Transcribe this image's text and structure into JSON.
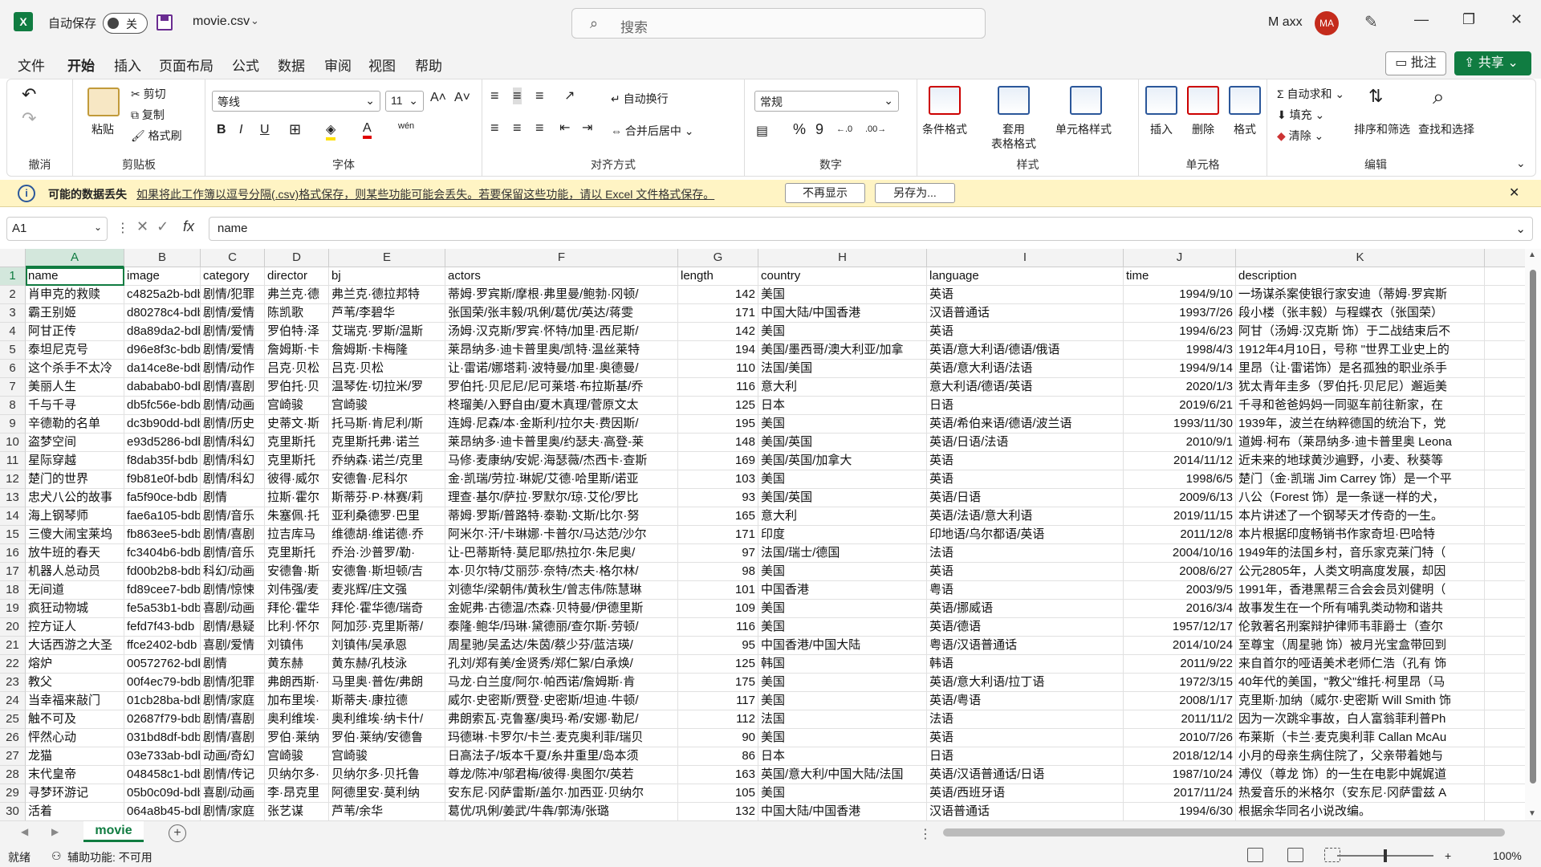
{
  "titlebar": {
    "autosave_label": "自动保存",
    "autosave_state": "关",
    "filename": "movie.csv",
    "search_placeholder": "搜索",
    "user_name": "M axx",
    "avatar_initials": "MA"
  },
  "menu": {
    "tabs": [
      "文件",
      "开始",
      "插入",
      "页面布局",
      "公式",
      "数据",
      "审阅",
      "视图",
      "帮助"
    ],
    "active_tab": "开始",
    "comment_label": "批注",
    "share_label": "共享"
  },
  "ribbon": {
    "undo_group": "撤消",
    "clipboard": {
      "paste": "粘贴",
      "cut": "剪切",
      "copy": "复制",
      "format_painter": "格式刷",
      "label": "剪贴板"
    },
    "font": {
      "name": "等线",
      "size": "11",
      "label": "字体"
    },
    "alignment": {
      "wrap": "自动换行",
      "merge": "合并后居中",
      "label": "对齐方式"
    },
    "number": {
      "format": "常规",
      "label": "数字"
    },
    "styles": {
      "conditional": "条件格式",
      "table_line1": "套用",
      "table_line2": "表格格式",
      "cell_styles": "单元格样式",
      "label": "样式"
    },
    "cells": {
      "insert": "插入",
      "delete": "删除",
      "format": "格式",
      "label": "单元格"
    },
    "editing": {
      "autosum": "自动求和",
      "fill": "填充",
      "clear": "清除",
      "sort_filter": "排序和筛选",
      "find_select": "查找和选择",
      "label": "编辑"
    }
  },
  "infobar": {
    "title": "可能的数据丢失",
    "message": "如果将此工作簿以逗号分隔(.csv)格式保存，则某些功能可能会丢失。若要保留这些功能，请以 Excel 文件格式保存。",
    "dont_show": "不再显示",
    "save_as": "另存为..."
  },
  "formula_bar": {
    "cell_ref": "A1",
    "formula": "name"
  },
  "columns": [
    "A",
    "B",
    "C",
    "D",
    "E",
    "F",
    "G",
    "H",
    "I",
    "J",
    "K"
  ],
  "row_numbers": [
    "1",
    "2",
    "3",
    "4",
    "5",
    "6",
    "7",
    "8",
    "9",
    "10",
    "11",
    "12",
    "13",
    "14",
    "15",
    "16",
    "17",
    "18",
    "19",
    "20",
    "21",
    "22",
    "23",
    "24",
    "25",
    "26",
    "27",
    "28",
    "29",
    "30"
  ],
  "rows": [
    [
      "name",
      "image",
      "category",
      "director",
      "bj",
      "actors",
      "length",
      "country",
      "language",
      "time",
      "description"
    ],
    [
      "肖申克的救赎",
      "c4825a2b-bdb",
      "剧情/犯罪",
      "弗兰克·德",
      "弗兰克·德拉邦特",
      "蒂姆·罗宾斯/摩根·弗里曼/鲍勃·冈顿/",
      "142",
      "美国",
      "英语",
      "1994/9/10",
      "一场谋杀案使银行家安迪（蒂姆·罗宾斯"
    ],
    [
      "霸王别姬",
      "d80278c4-bdb",
      "剧情/爱情",
      "陈凯歌",
      "芦苇/李碧华",
      "张国荣/张丰毅/巩俐/葛优/英达/蒋雯",
      "171",
      "中国大陆/中国香港",
      "汉语普通话",
      "1993/7/26",
      "段小楼（张丰毅）与程蝶衣（张国荣）"
    ],
    [
      "阿甘正传",
      "d8a89da2-bdb",
      "剧情/爱情",
      "罗伯特·泽",
      "艾瑞克·罗斯/温斯",
      "汤姆·汉克斯/罗宾·怀特/加里·西尼斯/",
      "142",
      "美国",
      "英语",
      "1994/6/23",
      "阿甘（汤姆·汉克斯 饰）于二战结束后不"
    ],
    [
      "泰坦尼克号",
      "d96e8f3c-bdb",
      "剧情/爱情",
      "詹姆斯·卡",
      "詹姆斯·卡梅隆",
      "莱昂纳多·迪卡普里奥/凯特·温丝莱特",
      "194",
      "美国/墨西哥/澳大利亚/加拿",
      "英语/意大利语/德语/俄语",
      "1998/4/3",
      "1912年4月10日，号称 \"世界工业史上的"
    ],
    [
      "这个杀手不太冷",
      "da14ce8e-bdb",
      "剧情/动作",
      "吕克·贝松",
      "吕克·贝松",
      "让·雷诺/娜塔莉·波特曼/加里·奥德曼/",
      "110",
      "法国/美国",
      "英语/意大利语/法语",
      "1994/9/14",
      "里昂（让·雷诺饰）是名孤独的职业杀手"
    ],
    [
      "美丽人生",
      "dababab0-bdb",
      "剧情/喜剧",
      "罗伯托·贝",
      "温琴佐·切拉米/罗",
      "罗伯托·贝尼尼/尼可莱塔·布拉斯基/乔",
      "116",
      "意大利",
      "意大利语/德语/英语",
      "2020/1/3",
      "犹太青年圭多（罗伯托·贝尼尼）邂逅美"
    ],
    [
      "千与千寻",
      "db5fc56e-bdb",
      "剧情/动画",
      "宫崎骏",
      "宫崎骏",
      "柊瑠美/入野自由/夏木真理/菅原文太",
      "125",
      "日本",
      "日语",
      "2019/6/21",
      "千寻和爸爸妈妈一同驱车前往新家，在"
    ],
    [
      "辛德勒的名单",
      "dc3b90dd-bdb",
      "剧情/历史",
      "史蒂文·斯",
      "托马斯·肯尼利/斯",
      "连姆·尼森/本·金斯利/拉尔夫·费因斯/",
      "195",
      "美国",
      "英语/希伯来语/德语/波兰语",
      "1993/11/30",
      "1939年，波兰在纳粹德国的统治下，党"
    ],
    [
      "盗梦空间",
      "e93d5286-bdb",
      "剧情/科幻",
      "克里斯托",
      "克里斯托弗·诺兰",
      "莱昂纳多·迪卡普里奥/约瑟夫·高登-莱",
      "148",
      "美国/英国",
      "英语/日语/法语",
      "2010/9/1",
      "道姆·柯布（莱昂纳多·迪卡普里奥 Leona"
    ],
    [
      "星际穿越",
      "f8dab35f-bdb",
      "剧情/科幻",
      "克里斯托",
      "乔纳森·诺兰/克里",
      "马修·麦康纳/安妮·海瑟薇/杰西卡·查斯",
      "169",
      "美国/英国/加拿大",
      "英语",
      "2014/11/12",
      "近未来的地球黄沙遍野，小麦、秋葵等"
    ],
    [
      "楚门的世界",
      "f9b81e0f-bdb",
      "剧情/科幻",
      "彼得·威尔",
      "安德鲁·尼科尔",
      "金·凯瑞/劳拉·琳妮/艾德·哈里斯/诺亚",
      "103",
      "美国",
      "英语",
      "1998/6/5",
      "楚门（金·凯瑞 Jim Carrey 饰）是一个平"
    ],
    [
      "忠犬八公的故事",
      "fa5f90ce-bdb",
      "剧情",
      "拉斯·霍尔",
      "斯蒂芬·P·林赛/莉",
      "理查·基尔/萨拉·罗默尔/琼·艾伦/罗比",
      "93",
      "美国/英国",
      "英语/日语",
      "2009/6/13",
      "八公（Forest 饰）是一条谜一样的犬，"
    ],
    [
      "海上钢琴师",
      "fae6a105-bdb",
      "剧情/音乐",
      "朱塞佩·托",
      "亚利桑德罗·巴里",
      "蒂姆·罗斯/普路特·泰勒·文斯/比尔·努",
      "165",
      "意大利",
      "英语/法语/意大利语",
      "2019/11/15",
      "本片讲述了一个钢琴天才传奇的一生。"
    ],
    [
      "三傻大闹宝莱坞",
      "fb863ee5-bdb",
      "剧情/喜剧",
      "拉吉库马",
      "维德胡·维诺德·乔",
      "阿米尔·汗/卡琳娜·卡普尔/马达范/沙尔",
      "171",
      "印度",
      "印地语/乌尔都语/英语",
      "2011/12/8",
      "本片根据印度畅销书作家奇坦·巴哈特"
    ],
    [
      "放牛班的春天",
      "fc3404b6-bdb",
      "剧情/音乐",
      "克里斯托",
      "乔治·沙普罗/勒·",
      "让-巴蒂斯特·莫尼耶/热拉尔·朱尼奥/",
      "97",
      "法国/瑞士/德国",
      "法语",
      "2004/10/16",
      "1949年的法国乡村，音乐家克莱门特（"
    ],
    [
      "机器人总动员",
      "fd00b2b8-bdb",
      "科幻/动画",
      "安德鲁·斯",
      "安德鲁·斯坦顿/吉",
      "本·贝尔特/艾丽莎·奈特/杰夫·格尔林/",
      "98",
      "美国",
      "英语",
      "2008/6/27",
      "公元2805年，人类文明高度发展，却因"
    ],
    [
      "无间道",
      "fd89cee7-bdb",
      "剧情/惊悚",
      "刘伟强/麦",
      "麦兆辉/庄文强",
      "刘德华/梁朝伟/黄秋生/曾志伟/陈慧琳",
      "101",
      "中国香港",
      "粤语",
      "2003/9/5",
      "1991年，香港黑帮三合会会员刘健明（"
    ],
    [
      "疯狂动物城",
      "fe5a53b1-bdb",
      "喜剧/动画",
      "拜伦·霍华",
      "拜伦·霍华德/瑞奇",
      "金妮弗·古德温/杰森·贝特曼/伊德里斯",
      "109",
      "美国",
      "英语/挪威语",
      "2016/3/4",
      "故事发生在一个所有哺乳类动物和谐共"
    ],
    [
      "控方证人",
      "fefd7f43-bdb",
      "剧情/悬疑",
      "比利·怀尔",
      "阿加莎·克里斯蒂/",
      "泰隆·鲍华/玛琳·黛德丽/查尔斯·劳顿/",
      "116",
      "美国",
      "英语/德语",
      "1957/12/17",
      "伦敦著名刑案辩护律师韦菲爵士（查尔"
    ],
    [
      "大话西游之大圣",
      "ffce2402-bdb",
      "喜剧/爱情",
      "刘镇伟",
      "刘镇伟/吴承恩",
      "周星驰/吴孟达/朱茵/蔡少芬/蓝洁瑛/",
      "95",
      "中国香港/中国大陆",
      "粤语/汉语普通话",
      "2014/10/24",
      "至尊宝（周星驰 饰）被月光宝盒带回到"
    ],
    [
      "熔炉",
      "00572762-bdb",
      "剧情",
      "黄东赫",
      "黄东赫/孔枝泳",
      "孔刘/郑有美/金贤秀/郑仁絮/白承焕/",
      "125",
      "韩国",
      "韩语",
      "2011/9/22",
      "来自首尔的哑语美术老师仁浩（孔有 饰"
    ],
    [
      "教父",
      "00f4ec79-bdb",
      "剧情/犯罪",
      "弗朗西斯·",
      "马里奥·普佐/弗朗",
      "马龙·白兰度/阿尔·帕西诺/詹姆斯·肯",
      "175",
      "美国",
      "英语/意大利语/拉丁语",
      "1972/3/15",
      "40年代的美国，\"教父\"维托·柯里昂（马"
    ],
    [
      "当幸福来敲门",
      "01cb28ba-bdb",
      "剧情/家庭",
      "加布里埃·",
      "斯蒂夫·康拉德",
      "威尔·史密斯/贾登·史密斯/坦迪·牛顿/",
      "117",
      "美国",
      "英语/粤语",
      "2008/1/17",
      "克里斯·加纳（威尔·史密斯 Will Smith 饰"
    ],
    [
      "触不可及",
      "02687f79-bdb",
      "剧情/喜剧",
      "奥利维埃·",
      "奥利维埃·纳卡什/",
      "弗朗索瓦·克鲁塞/奥玛·希/安娜·勒尼/",
      "112",
      "法国",
      "法语",
      "2011/11/2",
      "因为一次跳伞事故，白人富翁菲利普Ph"
    ],
    [
      "怦然心动",
      "031bd8df-bdb",
      "剧情/喜剧",
      "罗伯·莱纳",
      "罗伯·莱纳/安德鲁",
      "玛德琳·卡罗尔/卡兰·麦克奥利菲/瑞贝",
      "90",
      "美国",
      "英语",
      "2010/7/26",
      "布莱斯（卡兰·麦克奥利菲 Callan McAu"
    ],
    [
      "龙猫",
      "03e733ab-bdb",
      "动画/奇幻",
      "宫崎骏",
      "宫崎骏",
      "日高法子/坂本千夏/糸井重里/岛本须",
      "86",
      "日本",
      "日语",
      "2018/12/14",
      "小月的母亲生病住院了，父亲带着她与"
    ],
    [
      "末代皇帝",
      "048458c1-bdb",
      "剧情/传记",
      "贝纳尔多·",
      "贝纳尔多·贝托鲁",
      "尊龙/陈冲/邬君梅/彼得·奥图尔/英若",
      "163",
      "英国/意大利/中国大陆/法国",
      "英语/汉语普通话/日语",
      "1987/10/24",
      "溥仪（尊龙 饰）的一生在电影中娓娓道"
    ],
    [
      "寻梦环游记",
      "05b0c09d-bdb",
      "喜剧/动画",
      "李·昂克里",
      "阿德里安·莫利纳",
      "安东尼·冈萨雷斯/盖尔·加西亚·贝纳尔",
      "105",
      "美国",
      "英语/西班牙语",
      "2017/11/24",
      "热爱音乐的米格尔（安东尼·冈萨雷兹 A"
    ],
    [
      "活着",
      "064a8b45-bdb",
      "剧情/家庭",
      "张艺谋",
      "芦苇/余华",
      "葛优/巩俐/姜武/牛犇/郭涛/张璐",
      "132",
      "中国大陆/中国香港",
      "汉语普通话",
      "1994/6/30",
      "根据余华同名小说改编。"
    ]
  ],
  "sheet": {
    "tab_name": "movie"
  },
  "status": {
    "ready": "就绪",
    "accessibility": "辅助功能: 不可用",
    "zoom": "100%"
  }
}
